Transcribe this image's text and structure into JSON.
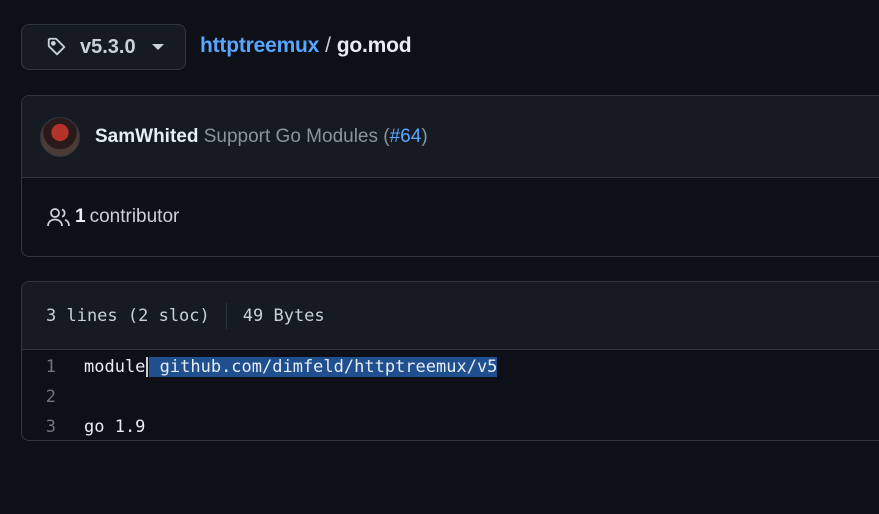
{
  "toolbar": {
    "tag_icon": "tag-icon",
    "branch_label": "v5.3.0"
  },
  "breadcrumb": {
    "repo": "httptreemux",
    "separator": "/",
    "file": "go.mod"
  },
  "commit": {
    "author": "SamWhited",
    "message": "Support Go Modules (",
    "pr": "#64",
    "message_end": ")"
  },
  "contributors": {
    "count": "1",
    "label": "contributor"
  },
  "file": {
    "lines_info": "3 lines (2 sloc)",
    "size": "49 Bytes",
    "lines": [
      {
        "num": "1",
        "pre": "module",
        "selected": " github.com/dimfeld/httptreemux/v5"
      },
      {
        "num": "2",
        "pre": "",
        "selected": ""
      },
      {
        "num": "3",
        "pre": "go 1.9",
        "selected": ""
      }
    ]
  },
  "colors": {
    "background": "#0d1117",
    "panel": "#161b22",
    "border": "#30363d",
    "link": "#58a6ff",
    "selection": "#1f4f8f"
  }
}
